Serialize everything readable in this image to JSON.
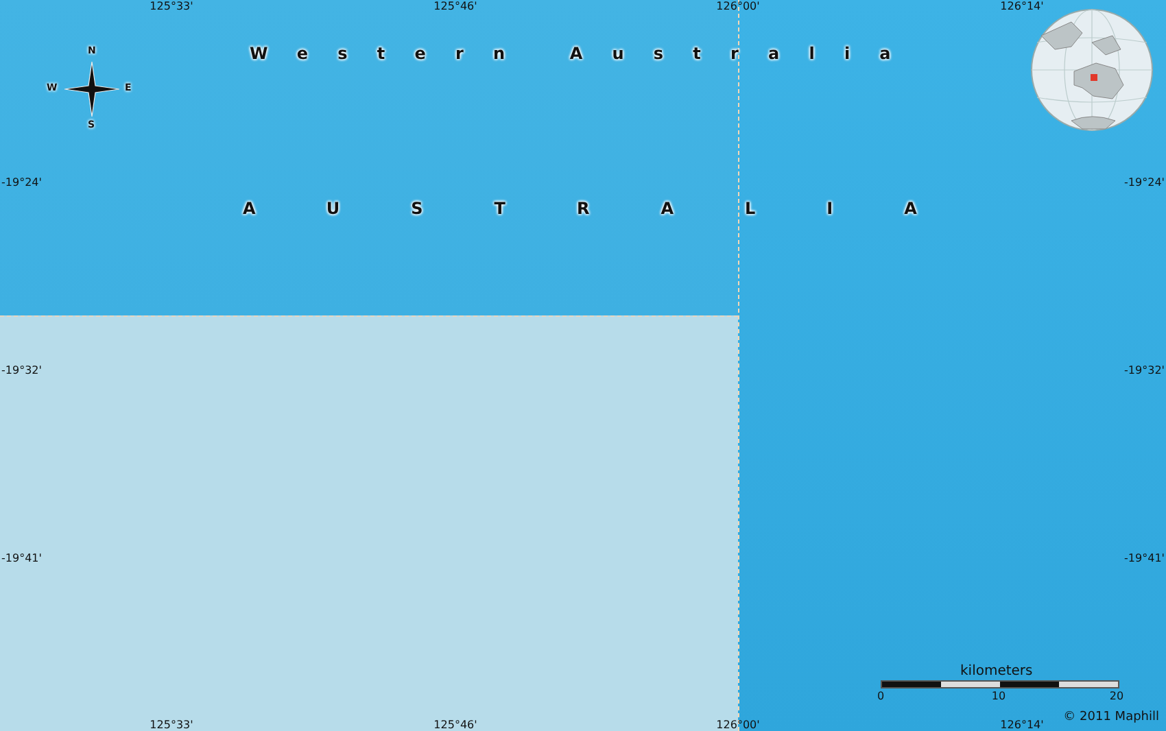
{
  "map": {
    "longitude_labels_top": [
      "125°33'",
      "125°46'",
      "126°00'",
      "126°14'"
    ],
    "longitude_labels_bottom": [
      "125°33'",
      "125°46'",
      "126°00'",
      "126°14'"
    ],
    "latitude_labels_left": [
      "-19°24'",
      "-19°32'",
      "-19°41'"
    ],
    "latitude_labels_right": [
      "-19°24'",
      "-19°32'",
      "-19°41'"
    ],
    "region_label": "Western Australia",
    "country_label": "AUSTRALIA",
    "compass": {
      "north": "N",
      "south": "S",
      "east": "E",
      "west": "W"
    },
    "scale_bar": {
      "unit": "kilometers",
      "ticks": [
        "0",
        "10",
        "20"
      ]
    },
    "copyright": "© 2011 Maphill"
  }
}
